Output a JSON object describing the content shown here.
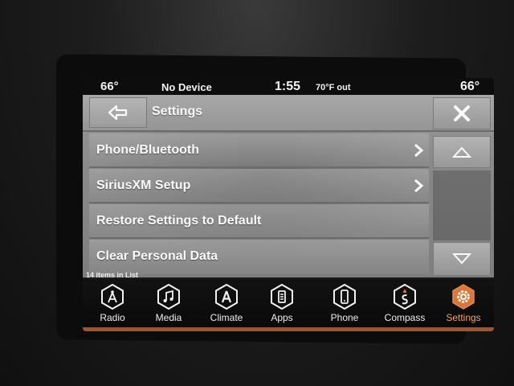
{
  "status": {
    "temp_left": "66°",
    "device": "No Device",
    "time": "1:55",
    "outside": "70°F out",
    "temp_right": "66°"
  },
  "header": {
    "title": "Settings",
    "back_icon": "back-arrow-icon",
    "close_icon": "close-icon"
  },
  "list": {
    "items": [
      {
        "label": "Phone/Bluetooth",
        "has_arrow": true
      },
      {
        "label": "SiriusXM Setup",
        "has_arrow": true
      },
      {
        "label": "Restore Settings to Default",
        "has_arrow": false
      },
      {
        "label": "Clear Personal Data",
        "has_arrow": false
      }
    ],
    "count_text": "14 items in List"
  },
  "nav": {
    "items": [
      {
        "label": "Radio",
        "icon": "radio-icon"
      },
      {
        "label": "Media",
        "icon": "music-note-icon"
      },
      {
        "label": "Climate",
        "icon": "climate-icon"
      },
      {
        "label": "Apps",
        "icon": "apps-icon"
      },
      {
        "label": "Phone",
        "icon": "phone-icon"
      },
      {
        "label": "Compass",
        "icon": "compass-icon"
      },
      {
        "label": "Settings",
        "icon": "gear-icon",
        "active": true
      }
    ]
  },
  "colors": {
    "accent": "#d9773a",
    "panel_gray": "#8f8f8f"
  }
}
